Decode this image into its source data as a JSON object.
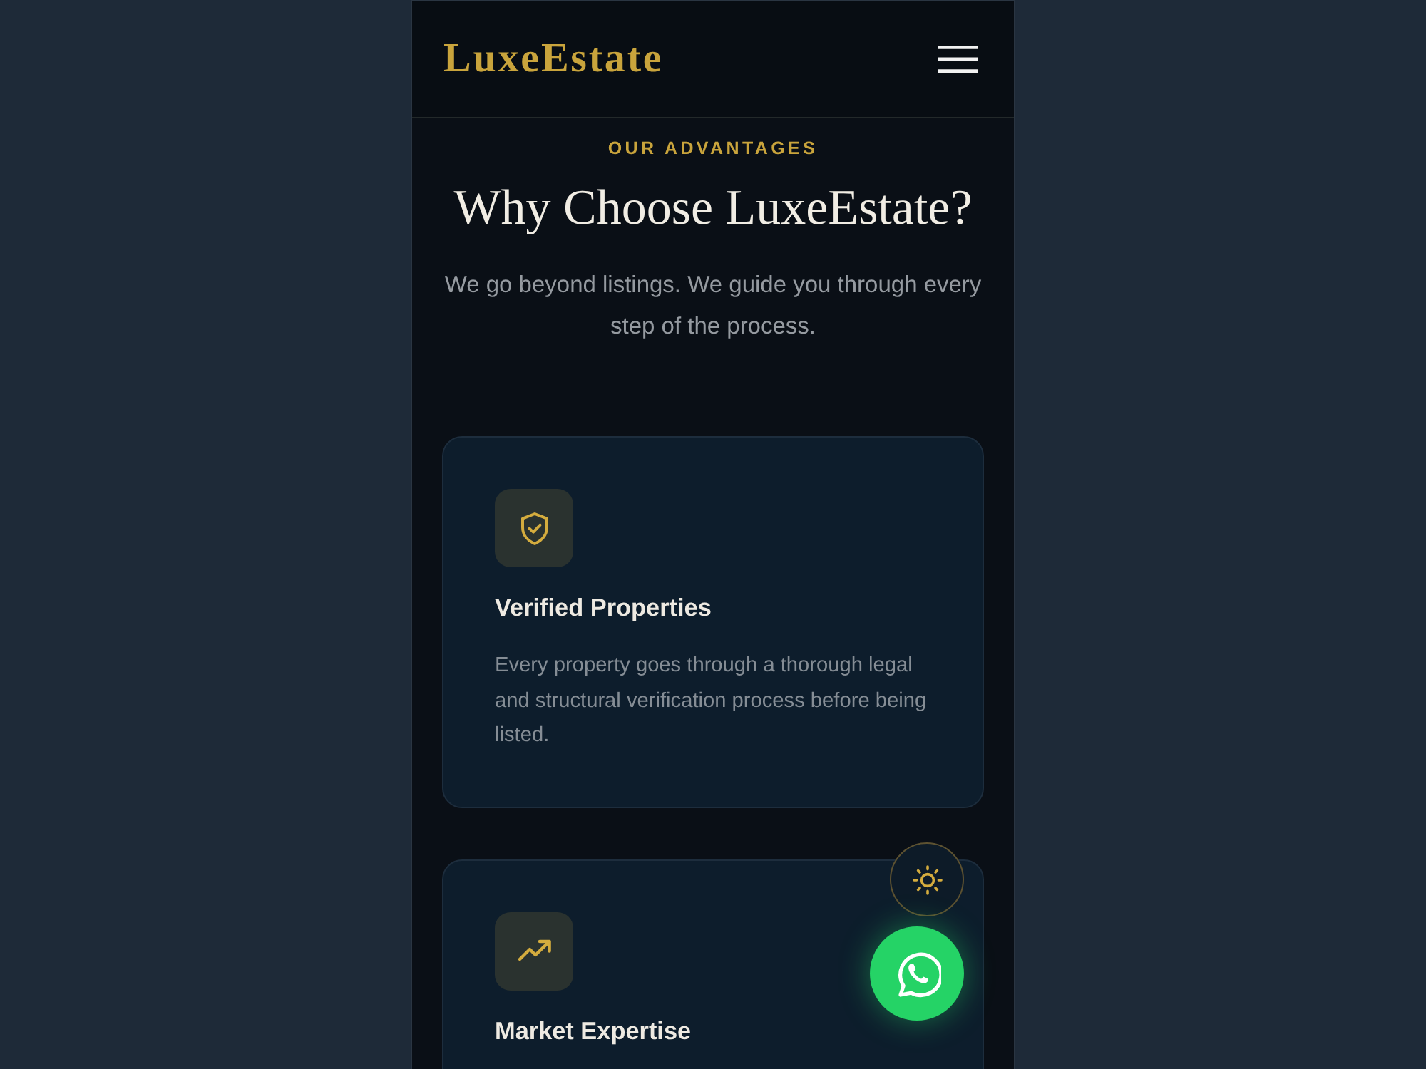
{
  "header": {
    "logo": "LuxeEstate"
  },
  "section": {
    "eyebrow": "OUR ADVANTAGES",
    "heading": "Why Choose LuxeEstate?",
    "intro": "We go beyond listings. We guide you through every step of the process."
  },
  "features": [
    {
      "kind": "shield",
      "title": "Verified Properties",
      "description": "Every property goes through a thorough legal and structural verification process before being listed."
    },
    {
      "kind": "trend",
      "title": "Market Expertise"
    }
  ]
}
